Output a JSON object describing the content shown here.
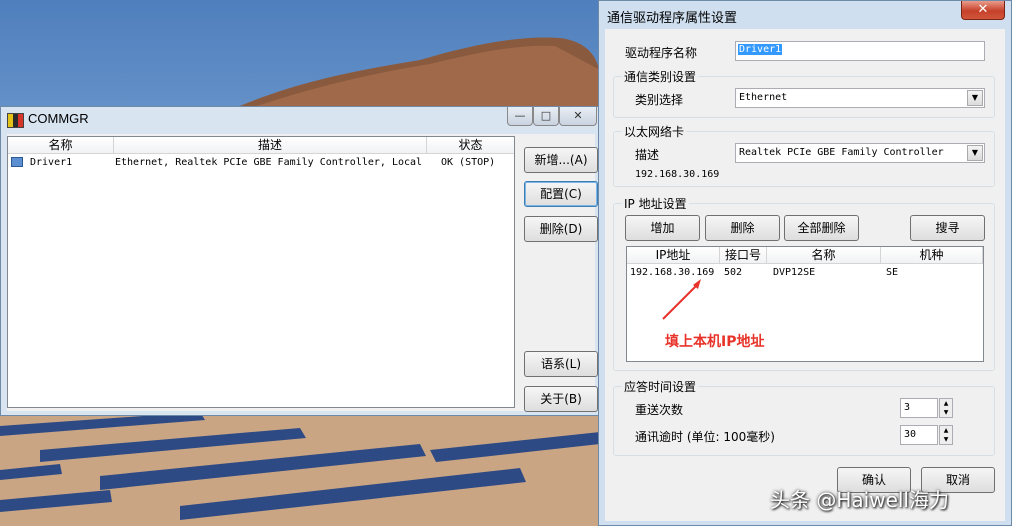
{
  "commgr": {
    "title": "COMMGR",
    "columns": [
      "名称",
      "描述",
      "状态"
    ],
    "rows": [
      {
        "name": "Driver1",
        "desc": "Ethernet, Realtek PCIe GBE Family Controller, Local",
        "status": "OK (STOP)"
      }
    ],
    "buttons": {
      "add": "新增...(A)",
      "config": "配置(C)",
      "delete": "删除(D)",
      "language": "语系(L)",
      "about": "关于(B)"
    }
  },
  "props": {
    "title": "通信驱动程序属性设置",
    "driver_name_label": "驱动程序名称",
    "driver_name_value": "Driver1",
    "comm_type": {
      "group": "通信类别设置",
      "label": "类别选择",
      "value": "Ethernet"
    },
    "ethernet": {
      "group": "以太网络卡",
      "label": "描述",
      "value": "Realtek PCIe GBE Family Controller",
      "ip": "192.168.30.169"
    },
    "ip_settings": {
      "group": "IP 地址设置",
      "buttons": {
        "add": "增加",
        "delete": "删除",
        "delete_all": "全部删除",
        "search": "搜寻"
      },
      "columns": [
        "IP地址",
        "接口号",
        "名称",
        "机种"
      ],
      "rows": [
        {
          "ip": "192.168.30.169",
          "port": "502",
          "name": "DVP12SE",
          "model": "SE"
        }
      ],
      "annotation": "填上本机IP地址"
    },
    "response": {
      "group": "应答时间设置",
      "retry_label": "重送次数",
      "retry_value": "3",
      "timeout_label": "通讯逾时 (单位: 100毫秒)",
      "timeout_value": "30"
    },
    "ok": "确认",
    "cancel": "取消"
  },
  "watermark": "头条 @Haiwell海力",
  "colors": {
    "accent": "#3399ff",
    "annotation": "#e8332a"
  }
}
